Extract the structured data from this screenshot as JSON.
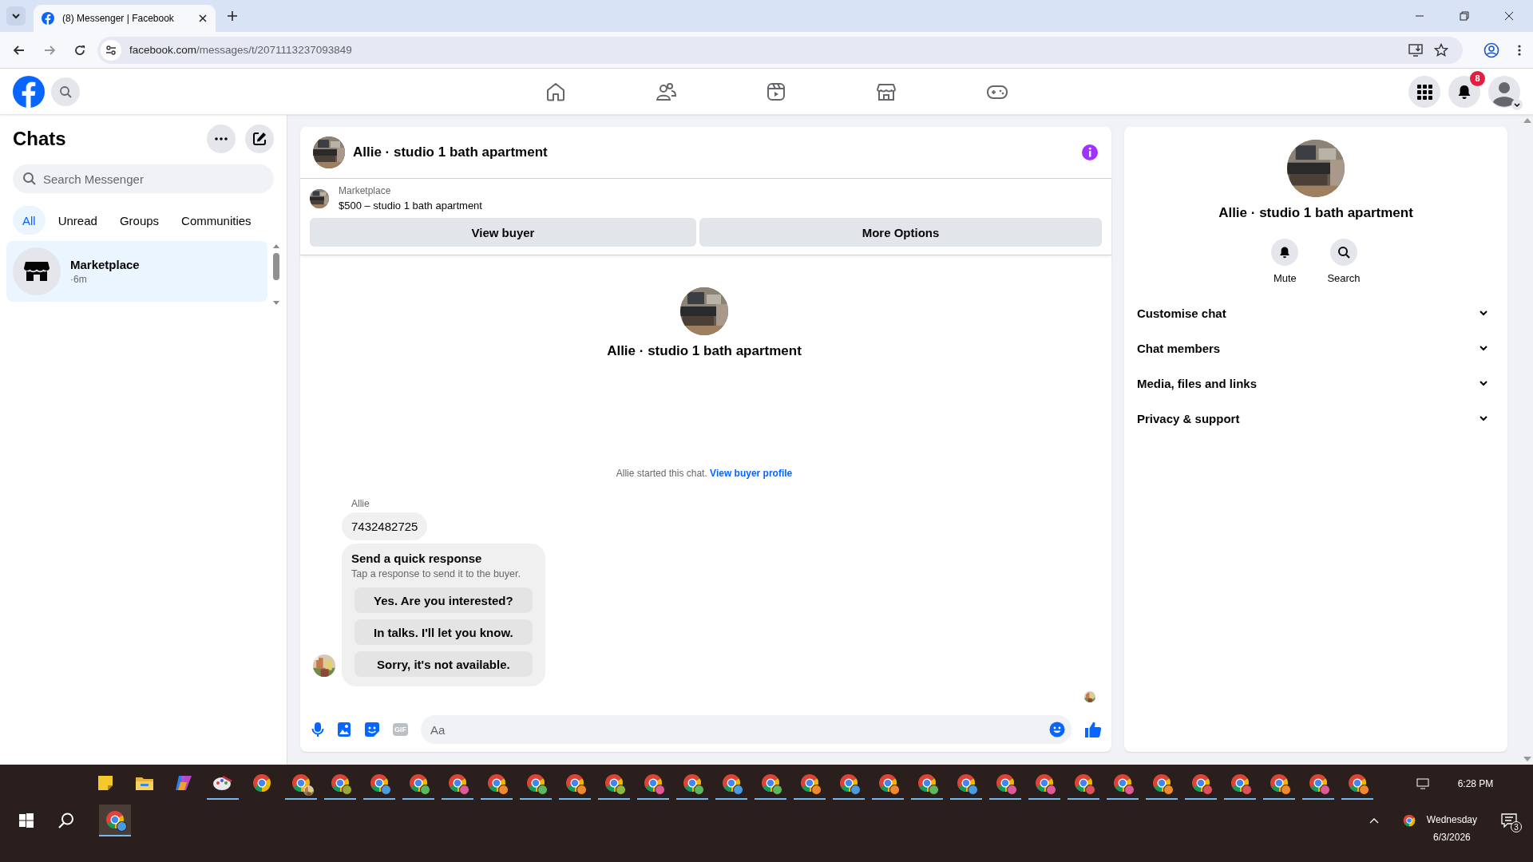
{
  "browser": {
    "tab_title": "(8) Messenger | Facebook",
    "url_host": "facebook.com",
    "url_path": "/messages/t/2071113237093849"
  },
  "navbar": {
    "notification_count": "8"
  },
  "sidebar": {
    "title": "Chats",
    "search_placeholder": "Search Messenger",
    "filters": [
      {
        "label": "All",
        "selected": true
      },
      {
        "label": "Unread",
        "selected": false
      },
      {
        "label": "Groups",
        "selected": false
      },
      {
        "label": "Communities",
        "selected": false
      }
    ],
    "chats": [
      {
        "name": "Marketplace",
        "time": "·6m",
        "selected": true
      }
    ]
  },
  "conversation": {
    "title": "Allie · studio 1 bath apartment",
    "listing": {
      "source": "Marketplace",
      "title": "$500 – studio 1 bath apartment"
    },
    "actions": [
      "View buyer",
      "More Options"
    ],
    "intro_name": "Allie · studio 1 bath apartment",
    "system_note": {
      "text": "Allie started this chat.",
      "link": "View buyer profile"
    },
    "messages": [
      {
        "sender": "Allie",
        "text": "7432482725"
      }
    ],
    "quick_response": {
      "title": "Send a quick response",
      "hint": "Tap a response to send it to the buyer.",
      "options": [
        "Yes. Are you interested?",
        "In talks. I'll let you know.",
        "Sorry, it's not available."
      ]
    },
    "composer": {
      "placeholder": "Aa",
      "gif_label": "GIF"
    }
  },
  "details": {
    "title": "Allie · studio 1 bath apartment",
    "actions": [
      {
        "kind": "mute",
        "label": "Mute"
      },
      {
        "kind": "search",
        "label": "Search"
      }
    ],
    "sections": [
      {
        "label": "Customise chat",
        "expanded": false
      },
      {
        "label": "Chat members",
        "expanded": false
      },
      {
        "label": "Media, files and links",
        "expanded": false
      },
      {
        "label": "Privacy & support",
        "expanded": false
      }
    ]
  },
  "taskbar": {
    "apps": [
      {
        "kind": "sticky-notes",
        "running": false
      },
      {
        "kind": "file-explorer",
        "running": false
      },
      {
        "kind": "copilot",
        "running": false
      },
      {
        "kind": "paint",
        "running": true
      },
      {
        "kind": "chrome",
        "running": false
      },
      {
        "kind": "chrome-photo",
        "running": true
      },
      {
        "kind": "chrome-profile",
        "running": true,
        "color": "#9aa83a"
      },
      {
        "kind": "chrome-profile",
        "running": true,
        "color": "#4a9be0"
      },
      {
        "kind": "chrome-profile",
        "running": true,
        "color": "#5cb85c"
      },
      {
        "kind": "chrome-profile",
        "running": true,
        "color": "#e05a9a"
      },
      {
        "kind": "chrome-profile",
        "running": true,
        "color": "#f08a30"
      },
      {
        "kind": "chrome-profile",
        "running": true,
        "color": "#5cb85c"
      },
      {
        "kind": "chrome-profile",
        "running": true,
        "color": "#f08a30"
      },
      {
        "kind": "chrome-profile",
        "running": true,
        "color": "#8ab840"
      },
      {
        "kind": "chrome-profile",
        "running": true,
        "color": "#e05a9a"
      },
      {
        "kind": "chrome-profile",
        "running": true,
        "color": "#5cb85c"
      },
      {
        "kind": "chrome-profile",
        "running": true,
        "color": "#4a9be0"
      },
      {
        "kind": "chrome-profile",
        "running": true,
        "color": "#5cb85c"
      },
      {
        "kind": "chrome-profile",
        "running": true,
        "color": "#f08a30"
      },
      {
        "kind": "chrome-profile",
        "running": true,
        "color": "#4a9be0"
      },
      {
        "kind": "chrome-profile",
        "running": true,
        "color": "#f08a30"
      },
      {
        "kind": "chrome-profile",
        "running": true,
        "color": "#5cb85c"
      },
      {
        "kind": "chrome-profile",
        "running": true,
        "color": "#4a9be0"
      },
      {
        "kind": "chrome-profile",
        "running": true,
        "color": "#e05a9a"
      },
      {
        "kind": "chrome-profile",
        "running": true,
        "color": "#e05a9a"
      },
      {
        "kind": "chrome-profile",
        "running": true,
        "color": "#e0505a"
      },
      {
        "kind": "chrome-profile",
        "running": true,
        "color": "#e05a9a"
      },
      {
        "kind": "chrome-profile",
        "running": true,
        "color": "#f08a30"
      },
      {
        "kind": "chrome-profile",
        "running": true,
        "color": "#e0505a"
      },
      {
        "kind": "chrome-profile",
        "running": true,
        "color": "#e0505a"
      },
      {
        "kind": "chrome-profile",
        "running": true,
        "color": "#f08a30"
      },
      {
        "kind": "chrome-profile",
        "running": true,
        "color": "#e05a9a"
      },
      {
        "kind": "chrome-profile",
        "running": true,
        "color": "#f08a30"
      }
    ],
    "active_app": {
      "kind": "chrome-profile",
      "running": true,
      "selected": true,
      "color": "#4a9be0"
    },
    "time": "6:28 PM",
    "day": "Wednesday",
    "date": "6/3/2026",
    "notification_count": "3"
  }
}
